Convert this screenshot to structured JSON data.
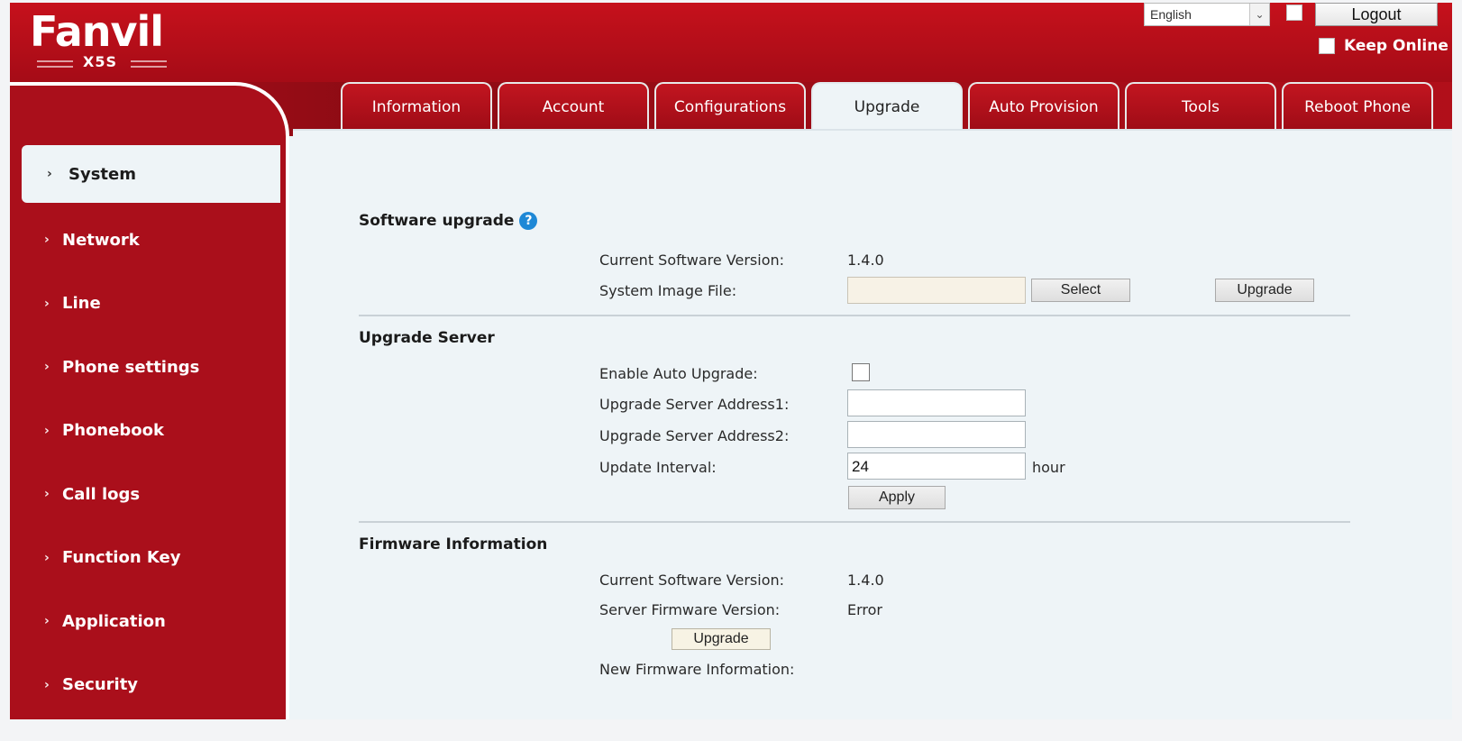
{
  "header": {
    "logo": "Fanvil",
    "model": "X5S",
    "language": "English",
    "logout_label": "Logout",
    "keep_online_label": "Keep Online"
  },
  "tabs": [
    {
      "label": "Information",
      "active": false
    },
    {
      "label": "Account",
      "active": false
    },
    {
      "label": "Configurations",
      "active": false
    },
    {
      "label": "Upgrade",
      "active": true
    },
    {
      "label": "Auto Provision",
      "active": false
    },
    {
      "label": "Tools",
      "active": false
    },
    {
      "label": "Reboot Phone",
      "active": false
    }
  ],
  "sidebar": {
    "items": [
      {
        "label": "System",
        "active": true
      },
      {
        "label": "Network",
        "active": false
      },
      {
        "label": "Line",
        "active": false
      },
      {
        "label": "Phone settings",
        "active": false
      },
      {
        "label": "Phonebook",
        "active": false
      },
      {
        "label": "Call logs",
        "active": false
      },
      {
        "label": "Function Key",
        "active": false
      },
      {
        "label": "Application",
        "active": false
      },
      {
        "label": "Security",
        "active": false
      }
    ]
  },
  "software_upgrade": {
    "title": "Software upgrade",
    "current_version_label": "Current Software Version:",
    "current_version_value": "1.4.0",
    "image_file_label": "System Image File:",
    "image_file_value": "",
    "select_label": "Select",
    "upgrade_label": "Upgrade"
  },
  "upgrade_server": {
    "title": "Upgrade Server",
    "enable_auto_label": "Enable Auto Upgrade:",
    "enable_auto_checked": false,
    "address1_label": "Upgrade Server Address1:",
    "address1_value": "",
    "address2_label": "Upgrade Server Address2:",
    "address2_value": "",
    "interval_label": "Update Interval:",
    "interval_value": "24",
    "interval_unit": "hour",
    "apply_label": "Apply"
  },
  "firmware_info": {
    "title": "Firmware Information",
    "current_version_label": "Current Software Version:",
    "current_version_value": "1.4.0",
    "server_version_label": "Server Firmware Version:",
    "server_version_value": "Error",
    "upgrade_label": "Upgrade",
    "new_info_label": "New Firmware Information:"
  },
  "colors": {
    "brand_red": "#aa0f1b",
    "content_bg": "#eef4f7",
    "help_blue": "#1e88d6"
  }
}
